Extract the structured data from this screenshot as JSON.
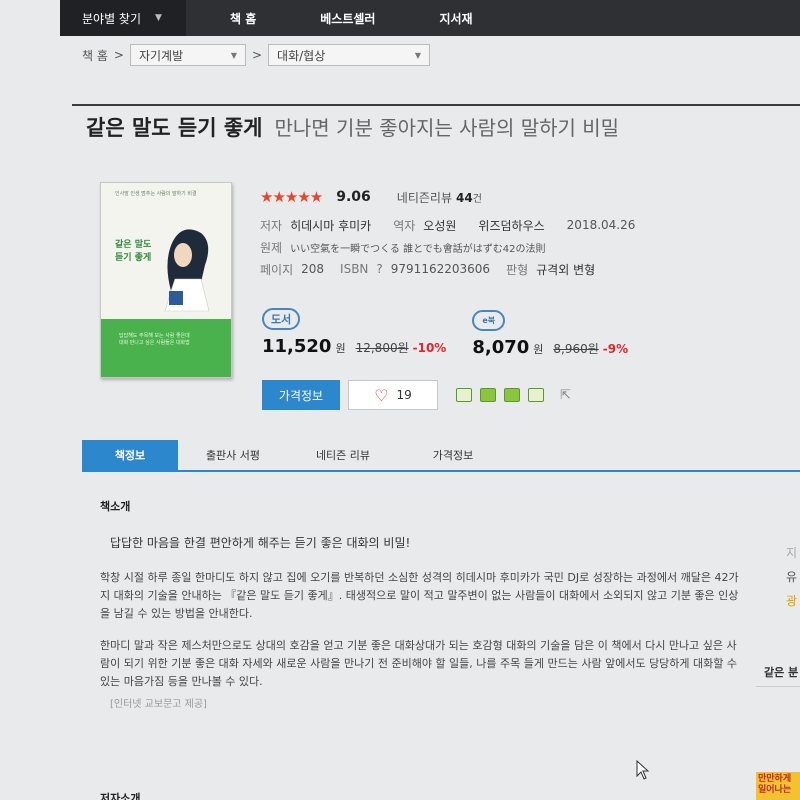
{
  "nav": {
    "category": "분야별 찾기",
    "menu": [
      "책 홈",
      "베스트셀러",
      "지서재"
    ]
  },
  "breadcrumb": {
    "home": "책 홈",
    "level1": "자기계발",
    "level2": "대화/협상"
  },
  "book": {
    "title": "같은 말도 듣기 좋게",
    "subtitle": "만나면 기분 좋아지는 사람의 말하기 비밀",
    "cover": {
      "top_text": "인사말 인생 멈추는 사람의 말하기 비결",
      "title_line1": "같은 말도",
      "title_line2": "듣기 좋게",
      "band_text_1": "답답해도 주목해 보는 사람 좋은데",
      "band_text_2": "대화 만나고 싶은 사람들은 대화법"
    },
    "rating": {
      "stars": "★★★★★",
      "score": "9.06",
      "review_label": "네티즌리뷰",
      "review_count": "44",
      "review_unit": "건"
    },
    "author_label": "저자",
    "author": "히데시마 후미카",
    "translator_label": "역자",
    "translator": "오성원",
    "publisher": "위즈덤하우스",
    "date": "2018.04.26",
    "original_label": "원제",
    "original_title": "いい空氣を一瞬でつくる 誰とでも會話がはずむ42の法則",
    "pages_label": "페이지",
    "pages": "208",
    "isbn_label": "ISBN",
    "isbn_help": "?",
    "isbn": "9791162203606",
    "format_label": "판형",
    "format": "규격외 변형"
  },
  "prices": {
    "paper": {
      "badge": "도서",
      "price": "11,520",
      "unit": "원",
      "original": "12,800원",
      "discount": "-10%"
    },
    "ebook": {
      "badge": "e북",
      "price": "8,070",
      "unit": "원",
      "original": "8,960원",
      "discount": "-9%"
    }
  },
  "actions": {
    "price_info": "가격정보",
    "like_count": "19"
  },
  "tabs": [
    "책정보",
    "출판사 서평",
    "네티즌 리뷰",
    "가격정보"
  ],
  "content": {
    "section_title": "책소개",
    "intro": "답답한 마음을 한결 편안하게 해주는 듣기 좋은 대화의 비밀!",
    "paragraph1": "학창 시절 하루 종일 한마디도 하지 않고 집에 오기를 반복하던 소심한 성격의 히데시마 후미카가 국민 DJ로 성장하는 과정에서 깨달은 42가지 대화의 기술을 안내하는 『같은 말도 듣기 좋게』. 태생적으로 말이 적고 말주변이 없는 사람들이 대화에서 소외되지 않고 기분 좋은 인상을 남길 수 있는 방법을 안내한다.",
    "paragraph2": "한마디 말과 작은 제스처만으로도 상대의 호감을 얻고 기분 좋은 대화상대가 되는 호감형 대화의 기술을 담은 이 책에서 다시 만나고 싶은 사람이 되기 위한 기분 좋은 대화 자세와 새로운 사람을 만나기 전 준비해야 할 일들, 나를 주목 들게 만드는 사람 앞에서도 당당하게 대화할 수 있는 마음가짐 등을 만나볼 수 있다.",
    "source": "[인터넷 교보문고 제공]",
    "author_section": "저자소개"
  },
  "sidebar": {
    "s1": "지",
    "s2": "유",
    "s3": "광",
    "related": "같은 분",
    "ad": "만만하게 일어나는"
  }
}
